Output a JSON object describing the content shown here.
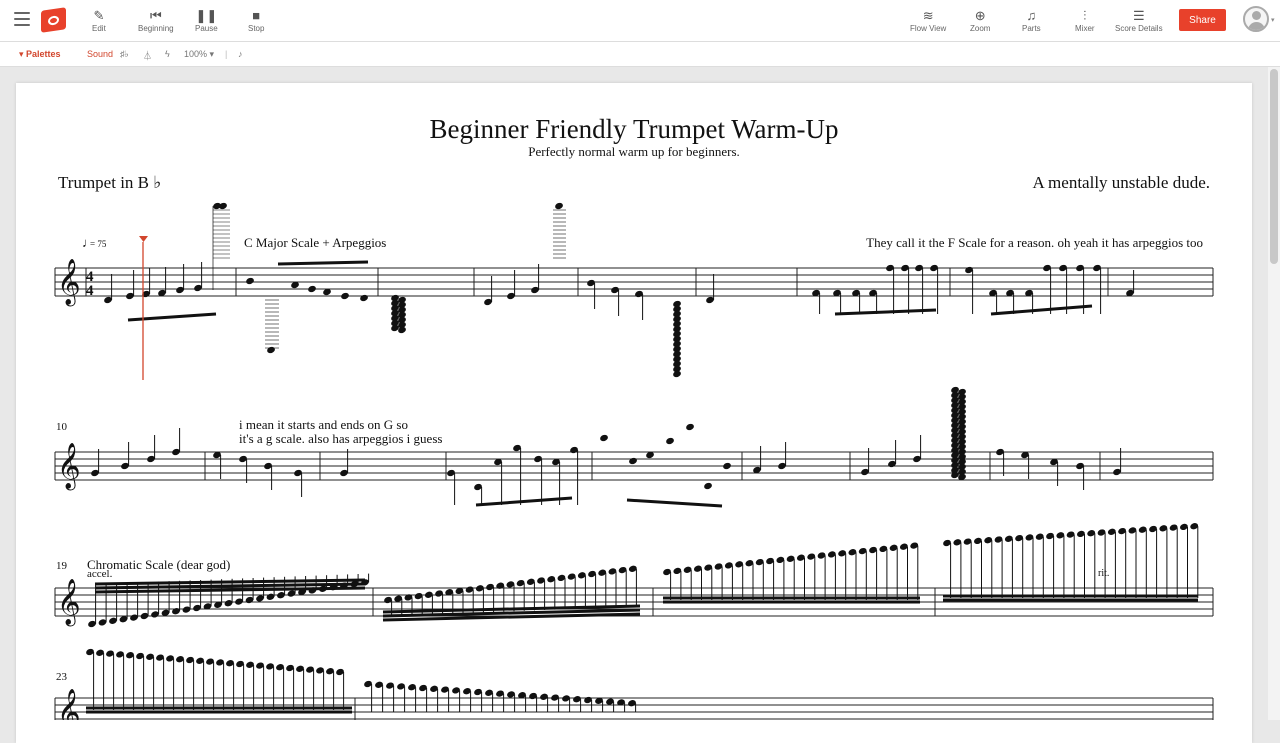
{
  "toolbar": {
    "edit": "Edit",
    "beginning": "Beginning",
    "pause": "Pause",
    "stop": "Stop",
    "flow_view": "Flow View",
    "zoom": "Zoom",
    "parts": "Parts",
    "mixer": "Mixer",
    "score_details": "Score Details",
    "share": "Share"
  },
  "subbar": {
    "palettes": "Palettes",
    "sound": "Sound",
    "zoom_level": "100%"
  },
  "score": {
    "title": "Beginner Friendly Trumpet Warm-Up",
    "subtitle": "Perfectly normal warm up for beginners.",
    "instrument": "Trumpet in B ♭",
    "composer": "A mentally unstable dude.",
    "tempo": "= 75",
    "text1": "C Major Scale + Arpeggios",
    "text2": "They call it the F Scale for a reason. oh yeah it has arpeggios too",
    "text3_line1": "i mean it starts and ends on G so",
    "text3_line2": "it's a g scale. also has arpeggios i guess",
    "text4": "Chromatic Scale (dear god)",
    "accel": "accel.",
    "rit": "rit.",
    "measure_10": "10",
    "measure_19": "19",
    "measure_23": "23"
  },
  "colors": {
    "accent": "#e8412b",
    "playhead": "#d2462d"
  }
}
